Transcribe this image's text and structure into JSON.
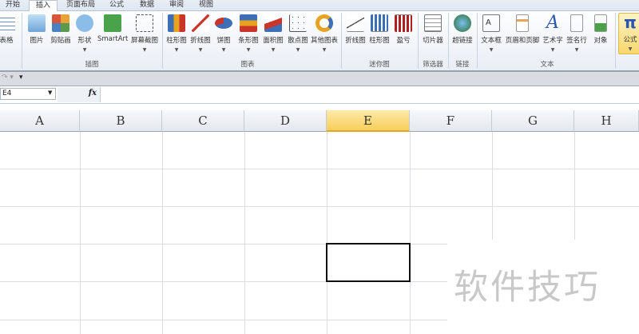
{
  "tabs": [
    "开始",
    "插入",
    "页面布局",
    "公式",
    "数据",
    "审阅",
    "视图"
  ],
  "active_tab": "插入",
  "ribbon": {
    "table": "表格",
    "illustrations": {
      "label": "插图",
      "items": [
        "图片",
        "剪贴画",
        "形状",
        "SmartArt",
        "屏幕截图"
      ]
    },
    "charts": {
      "label": "图表",
      "items": [
        "柱形图",
        "折线图",
        "饼图",
        "条形图",
        "面积图",
        "散点图",
        "其他图表"
      ]
    },
    "sparklines": {
      "label": "迷你图",
      "items": [
        "折线图",
        "柱形图",
        "盈亏"
      ]
    },
    "filter": {
      "label": "筛选器",
      "items": [
        "切片器"
      ]
    },
    "links": {
      "label": "链接",
      "items": [
        "超链接"
      ]
    },
    "text": {
      "label": "文本",
      "items": [
        "文本框",
        "页眉和页脚",
        "艺术字",
        "签名行",
        "对象"
      ]
    },
    "symbols": {
      "items": [
        "公式"
      ]
    }
  },
  "name_box": "E4",
  "fx": "fx",
  "columns": [
    "A",
    "B",
    "C",
    "D",
    "E",
    "F",
    "G",
    "H"
  ],
  "selected_column": "E",
  "watermark": "软件技巧"
}
